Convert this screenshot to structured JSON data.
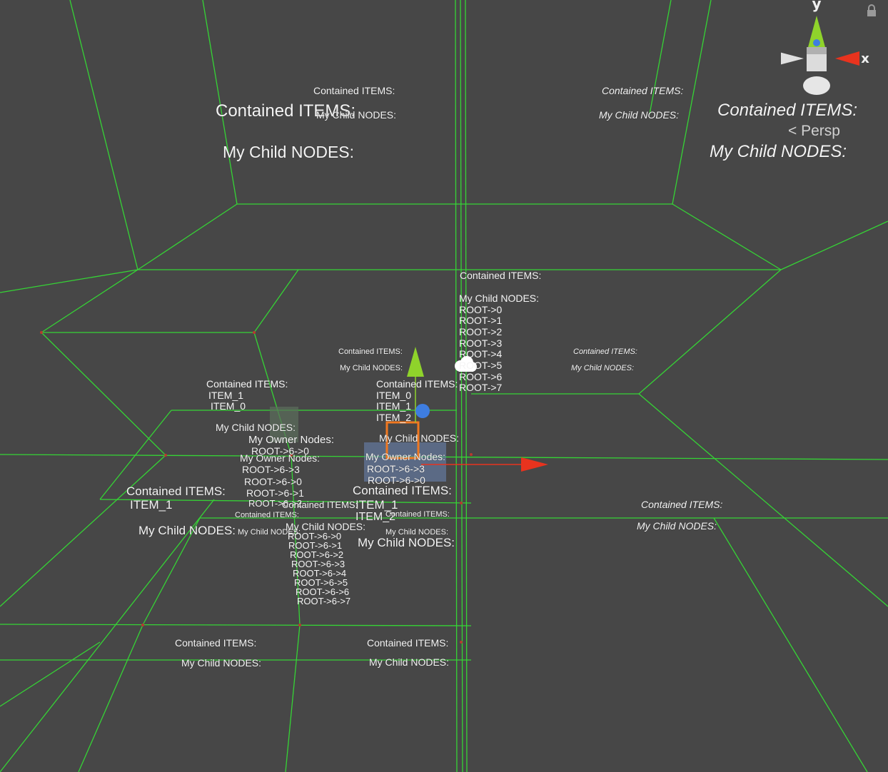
{
  "scene": {
    "view_mode": "Persp",
    "axis_labels": {
      "y": "y",
      "x": "x"
    },
    "colors": {
      "background": "#474747",
      "wireframe": "#35d435",
      "x_axis": "#e8331e",
      "y_axis": "#8fd32b",
      "z_axis": "#3e7de0",
      "selection": "#f07820"
    },
    "icons": [
      "lock-icon",
      "orientation-gizmo-icon",
      "move-tool-icon",
      "cloud-light-icon",
      "selected-cube-icon"
    ]
  },
  "labels": {
    "contained": "Contained ITEMS:",
    "child": "My Child NODES:",
    "owner": "My Owner Nodes:",
    "item0": "ITEM_0",
    "item1": "ITEM_1",
    "item2": "ITEM_2",
    "r0": "ROOT->0",
    "r1": "ROOT->1",
    "r2": "ROOT->2",
    "r3": "ROOT->3",
    "r4": "ROOT->4",
    "r5": "ROOT->5",
    "r6": "ROOT->6",
    "r7": "ROOT->7",
    "r60": "ROOT->6->0",
    "r61": "ROOT->6->1",
    "r62": "ROOT->6->2",
    "r63": "ROOT->6->3",
    "r64": "ROOT->6->4",
    "r65": "ROOT->6->5",
    "r66": "ROOT->6->6",
    "r67": "ROOT->6->7"
  }
}
